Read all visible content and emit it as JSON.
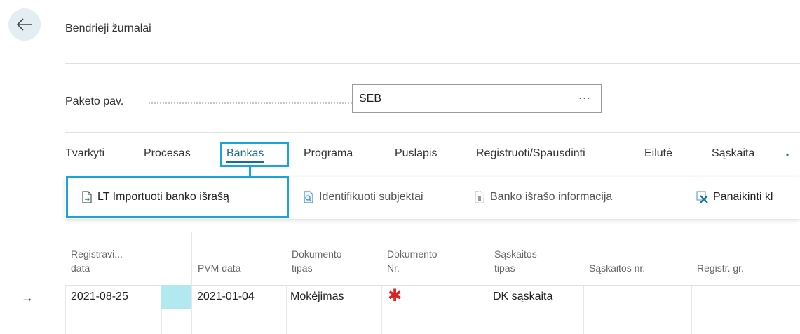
{
  "header": {
    "title": "Bendrieji žurnalai"
  },
  "batch": {
    "label": "Paketo pav.",
    "value": "SEB",
    "more": "···"
  },
  "tabs": [
    {
      "label": "Tvarkyti"
    },
    {
      "label": "Procesas"
    },
    {
      "label": "Bankas"
    },
    {
      "label": "Programa"
    },
    {
      "label": "Puslapis"
    },
    {
      "label": "Registruoti/Spausdinti"
    },
    {
      "label": "Eilutė"
    },
    {
      "label": "Sąskaita"
    }
  ],
  "actions": [
    {
      "label": "LT Importuoti banko išrašą",
      "icon": "import-file-icon"
    },
    {
      "label": "Identifikuoti subjektai",
      "icon": "identify-icon"
    },
    {
      "label": "Banko išrašo informacija",
      "icon": "document-info-icon"
    },
    {
      "label": "Panaikinti kl",
      "icon": "clear-x-icon"
    }
  ],
  "columns": [
    {
      "label": "Registravi...\ndata"
    },
    {
      "label": "PVM data"
    },
    {
      "label": "Dokumento\ntipas"
    },
    {
      "label": "Dokumento\nNr."
    },
    {
      "label": "Sąskaitos\ntipas"
    },
    {
      "label": "Sąskaitos nr."
    },
    {
      "label": "Registr. gr."
    }
  ],
  "rows": [
    {
      "posting_date": "2021-08-25",
      "vat_date": "2021-01-04",
      "doc_type": "Mokėjimas",
      "doc_no": "✱",
      "account_type": "DK sąskaita",
      "account_no": "",
      "posting_group": ""
    }
  ],
  "colors": {
    "accent": "#1b6e91",
    "highlight": "#1aa3dd",
    "required": "#e02020",
    "teal": "#b2e8ef"
  }
}
